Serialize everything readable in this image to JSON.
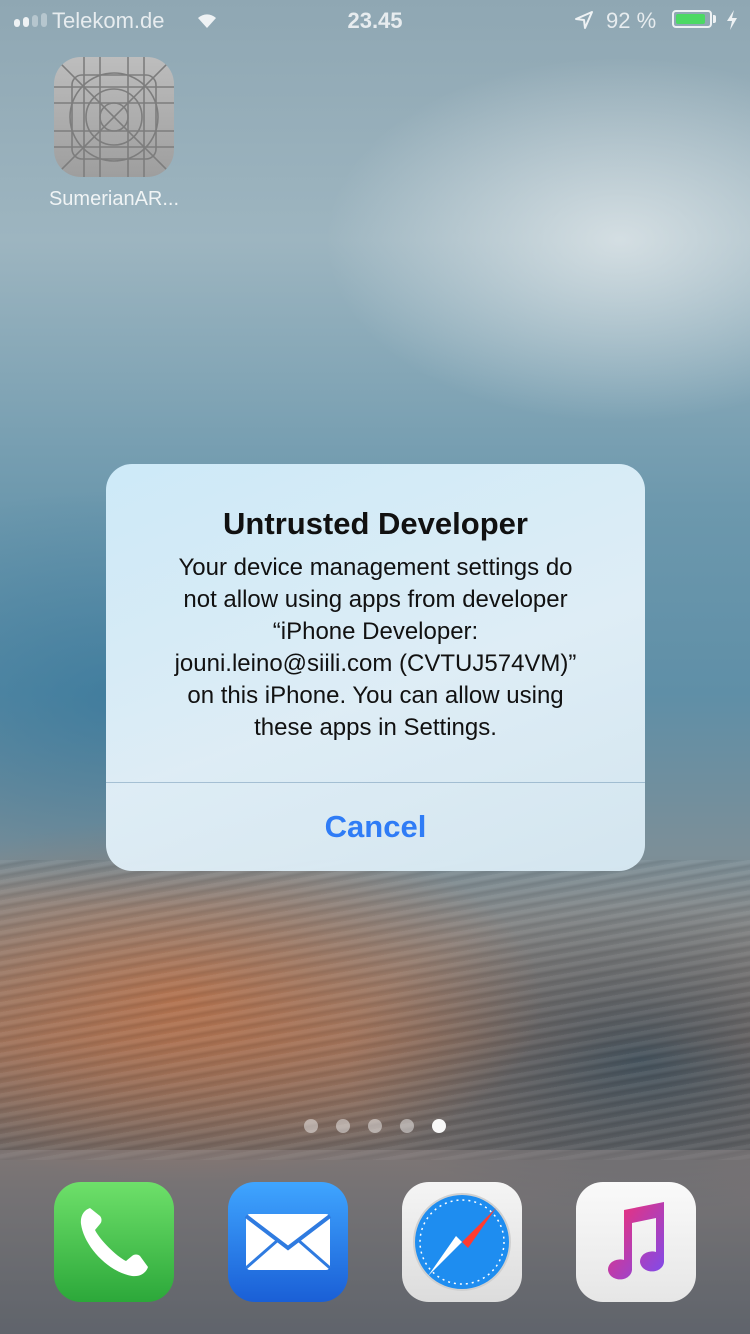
{
  "status_bar": {
    "carrier": "Telekom.de",
    "time": "23.45",
    "battery_percent": "92 %",
    "battery_level": 0.92,
    "signal_bars": 2
  },
  "home_screen": {
    "apps": [
      {
        "label": "SumerianAR...",
        "icon": "placeholder-app-icon"
      }
    ],
    "page_count": 5,
    "active_page": 5
  },
  "alert": {
    "title": "Untrusted Developer",
    "message": "Your device management settings do\nnot allow using apps from developer\n“iPhone Developer:\njouni.leino@siili.com (CVTUJ574VM)”\non this iPhone. You can allow using\nthese apps in Settings.",
    "cancel_label": "Cancel",
    "button_color": "#2f7cf6"
  },
  "dock": {
    "apps": [
      {
        "icon": "phone-icon"
      },
      {
        "icon": "mail-icon"
      },
      {
        "icon": "safari-compass-icon"
      },
      {
        "icon": "music-note-icon"
      }
    ]
  }
}
